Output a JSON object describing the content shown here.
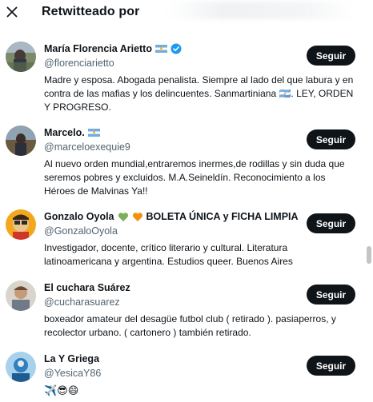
{
  "header": {
    "title": "Retwitteado por",
    "close_icon": "close-icon"
  },
  "users": [
    {
      "name": "María Florencia Arietto",
      "handle": "@florenciarietto",
      "bio": "Madre y esposa. Abogada penalista. Siempre al lado del que labura y en contra de las mafias y los delincuentes. Sanmartiniana 🇦🇷. LEY, ORDEN Y PROGRESO.",
      "follow_label": "Seguir",
      "verified": true
    },
    {
      "name": "Marcelo.",
      "handle": "@marceloexequie9",
      "bio": "Al nuevo orden mundial,entraremos inermes,de rodillas y sin duda que seremos pobres y excluidos. M.A.Seineldín. Reconocimiento a los Héroes de Malvinas Ya!!",
      "follow_label": "Seguir"
    },
    {
      "name": "Gonzalo Oyola",
      "name_suffix": "BOLETA ÚNICA y FICHA LIMPIA",
      "handle": "@GonzaloOyola",
      "bio": "Investigador, docente, crítico literario y cultural. Literatura latinoamericana y argentina. Estudios queer. Buenos Aires",
      "follow_label": "Seguir"
    },
    {
      "name": "El cuchara Suárez",
      "handle": "@cucharasuarez",
      "bio": "boxeador amateur del desagüe futbol club ( retirado ). pasiaperros, y recolector urbano. ( cartonero ) también retirado.",
      "follow_label": "Seguir"
    },
    {
      "name": "La Y Griega",
      "handle": "@YesicaY86",
      "bio": "✈️😎😄",
      "follow_label": "Seguir"
    }
  ],
  "colors": {
    "button_bg": "#0f1419",
    "secondary_text": "#536471",
    "verified_blue": "#1d9bf0"
  }
}
